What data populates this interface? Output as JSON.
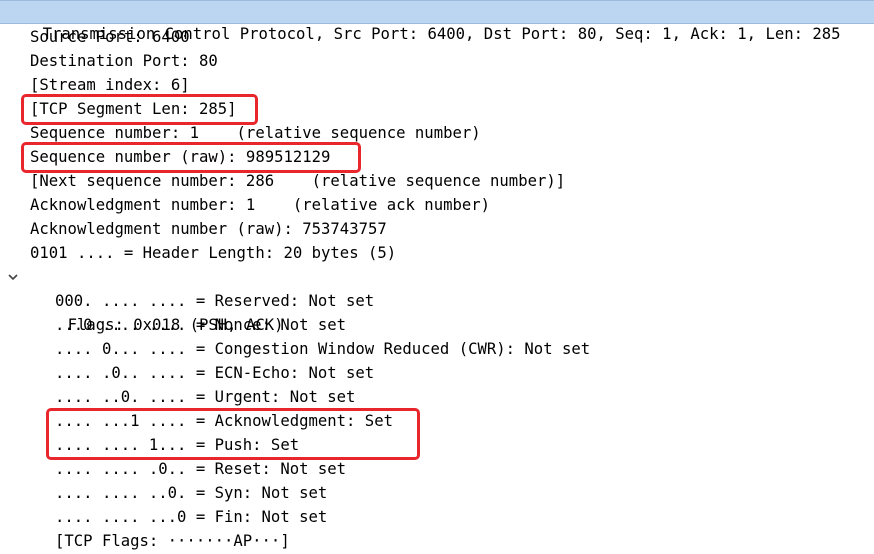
{
  "header": {
    "text": "Transmission Control Protocol, Src Port: 6400, Dst Port: 80, Seq: 1, Ack: 1, Len: 285"
  },
  "fields": [
    "Source Port: 6400",
    "Destination Port: 80",
    "[Stream index: 6]",
    "[TCP Segment Len: 285]",
    "Sequence number: 1    (relative sequence number)",
    "Sequence number (raw): 989512129",
    "[Next sequence number: 286    (relative sequence number)]",
    "Acknowledgment number: 1    (relative ack number)",
    "Acknowledgment number (raw): 753743757",
    "0101 .... = Header Length: 20 bytes (5)"
  ],
  "flags": {
    "label": "Flags: 0x018 (PSH, ACK)",
    "expander_icon": "chevron-down-icon",
    "items": [
      "000. .... .... = Reserved: Not set",
      "...0 .... .... = Nonce: Not set",
      ".... 0... .... = Congestion Window Reduced (CWR): Not set",
      ".... .0.. .... = ECN-Echo: Not set",
      ".... ..0. .... = Urgent: Not set",
      ".... ...1 .... = Acknowledgment: Set",
      ".... .... 1... = Push: Set",
      ".... .... .0.. = Reset: Not set",
      ".... .... ..0. = Syn: Not set",
      ".... .... ...0 = Fin: Not set",
      "[TCP Flags: ·······AP···]"
    ]
  },
  "colors": {
    "header_bg": "#bcd5f0",
    "highlight": "#e8262b"
  }
}
